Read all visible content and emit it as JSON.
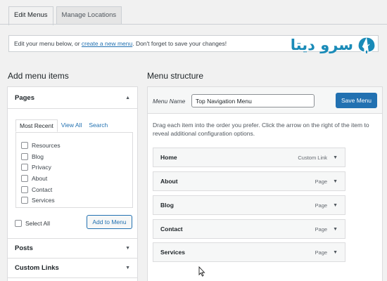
{
  "tabs": [
    {
      "label": "Edit Menus",
      "active": true
    },
    {
      "label": "Manage Locations",
      "active": false
    }
  ],
  "notice": {
    "before": "Edit your menu below, or ",
    "link": "create a new menu",
    "after": ". Don't forget to save your changes!"
  },
  "logo": {
    "text": "سرو دیتا",
    "icon": "tree-icon",
    "color": "#1a8bb8"
  },
  "left": {
    "heading": "Add menu items",
    "pages": {
      "title": "Pages",
      "tabs": [
        "Most Recent",
        "View All",
        "Search"
      ],
      "items": [
        "Resources",
        "Blog",
        "Privacy",
        "About",
        "Contact",
        "Services"
      ],
      "select_all": "Select All",
      "add_button": "Add to Menu"
    },
    "posts_title": "Posts",
    "custom_links_title": "Custom Links"
  },
  "right": {
    "heading": "Menu structure",
    "menu_name_label": "Menu Name",
    "menu_name_value": "Top Navigation Menu",
    "save_button": "Save Menu",
    "instructions": "Drag each item into the order you prefer. Click the arrow on the right of the item to reveal additional configuration options.",
    "items": [
      {
        "title": "Home",
        "type": "Custom Link"
      },
      {
        "title": "About",
        "type": "Page"
      },
      {
        "title": "Blog",
        "type": "Page"
      },
      {
        "title": "Contact",
        "type": "Page"
      },
      {
        "title": "Services",
        "type": "Page"
      }
    ]
  },
  "colors": {
    "accent": "#2271b1",
    "background": "#f1f1f1"
  }
}
